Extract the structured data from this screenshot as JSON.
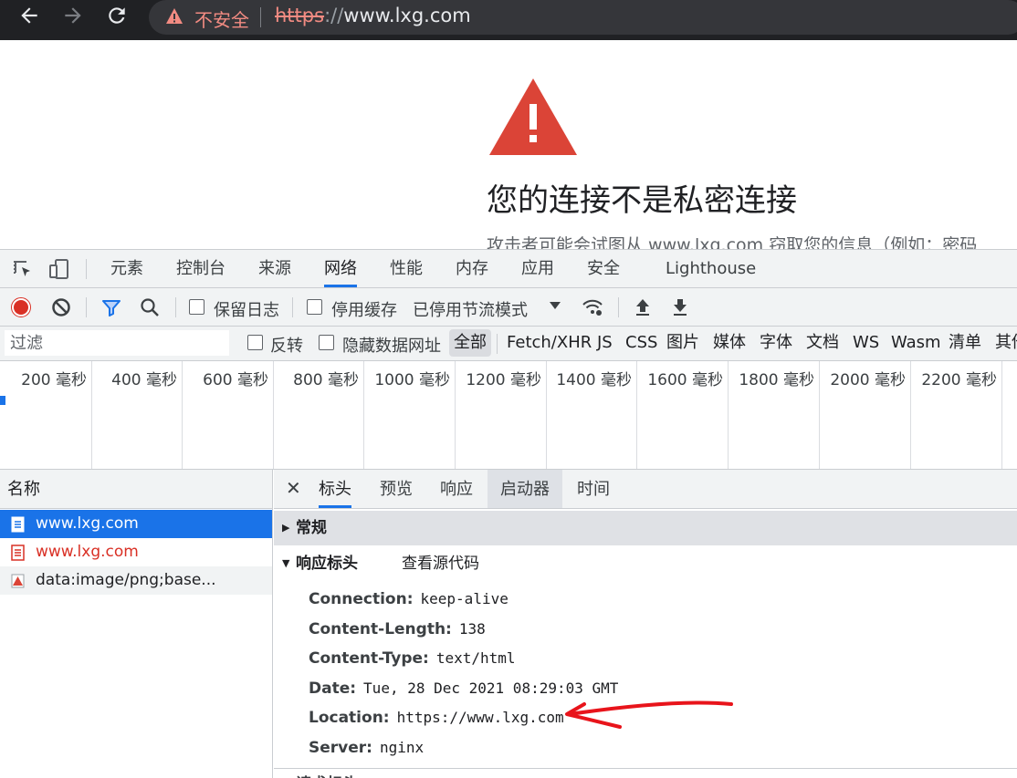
{
  "browser": {
    "security_label": "不安全",
    "url_scheme": "https",
    "url_sep": "://",
    "url_host": "www.lxg.com"
  },
  "interstitial": {
    "title": "您的连接不是私密连接",
    "body": "攻击者可能会试图从 www.lxg.com 窃取您的信息（例如：密码",
    "warning_color": "#db4437"
  },
  "devtools": {
    "tabs": [
      "元素",
      "控制台",
      "来源",
      "网络",
      "性能",
      "内存",
      "应用",
      "安全",
      "Lighthouse"
    ],
    "active_tab": "网络",
    "toolbar": {
      "preserve_log": "保留日志",
      "disable_cache": "停用缓存",
      "throttling": "已停用节流模式"
    },
    "filter": {
      "placeholder": "过滤",
      "invert": "反转",
      "hide_data_urls": "隐藏数据网址",
      "types": [
        "全部",
        "Fetch/XHR",
        "JS",
        "CSS",
        "图片",
        "媒体",
        "字体",
        "文档",
        "WS",
        "Wasm",
        "清单",
        "其他"
      ],
      "active_type": "全部"
    },
    "overview_ticks": [
      "200 毫秒",
      "400 毫秒",
      "600 毫秒",
      "800 毫秒",
      "1000 毫秒",
      "1200 毫秒",
      "1400 毫秒",
      "1600 毫秒",
      "1800 毫秒",
      "2000 毫秒",
      "2200 毫秒"
    ],
    "request_list": {
      "header": "名称",
      "rows": [
        {
          "name": "www.lxg.com",
          "selected": true,
          "status": "ok"
        },
        {
          "name": "www.lxg.com",
          "selected": false,
          "status": "error"
        },
        {
          "name": "data:image/png;base...",
          "selected": false,
          "status": "image"
        }
      ]
    },
    "detail": {
      "tabs": [
        "标头",
        "预览",
        "响应",
        "启动器",
        "时间"
      ],
      "active_tab": "标头",
      "general": "常规",
      "response_headers": "响应标头",
      "view_source": "查看源代码",
      "headers": [
        {
          "key": "Connection:",
          "value": "keep-alive"
        },
        {
          "key": "Content-Length:",
          "value": "138"
        },
        {
          "key": "Content-Type:",
          "value": "text/html"
        },
        {
          "key": "Date:",
          "value": "Tue, 28 Dec 2021 08:29:03 GMT"
        },
        {
          "key": "Location:",
          "value": "https://www.lxg.com"
        },
        {
          "key": "Server:",
          "value": "nginx"
        }
      ],
      "next_section": "请求标头"
    }
  },
  "colors": {
    "accent": "#1a73e8",
    "error": "#d93025",
    "annotation": "#e8141b"
  }
}
